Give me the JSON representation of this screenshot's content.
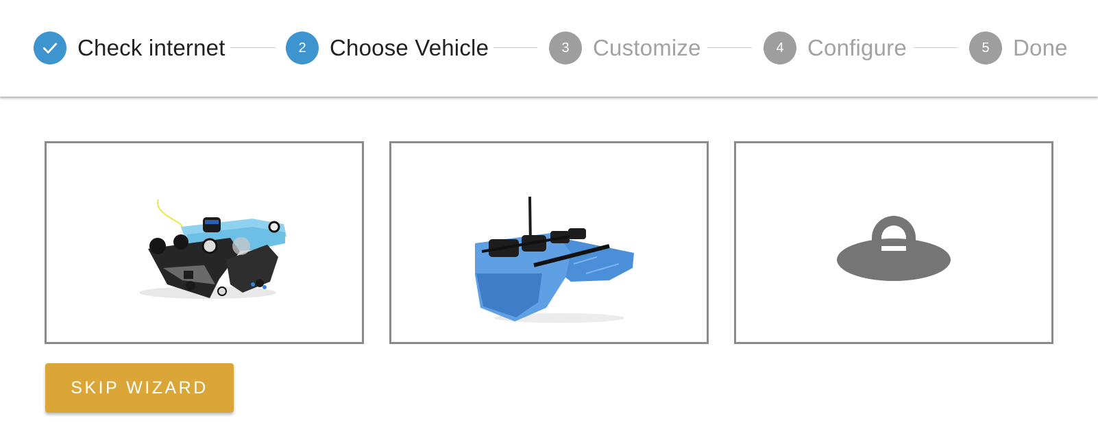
{
  "colors": {
    "accent": "#3d94cf",
    "pending": "#9e9e9e",
    "button": "#daa638",
    "card_border": "#8a8a8a"
  },
  "stepper": {
    "steps": [
      {
        "number": "1",
        "label": "Check internet",
        "state": "complete",
        "icon": "check-icon"
      },
      {
        "number": "2",
        "label": "Choose Vehicle",
        "state": "active"
      },
      {
        "number": "3",
        "label": "Customize",
        "state": "pending"
      },
      {
        "number": "4",
        "label": "Configure",
        "state": "pending"
      },
      {
        "number": "5",
        "label": "Done",
        "state": "pending"
      }
    ]
  },
  "vehicles": [
    {
      "id": "rov",
      "icon": "underwater-rov-image"
    },
    {
      "id": "boat",
      "icon": "catamaran-boat-image"
    },
    {
      "id": "other",
      "icon": "ufo-icon"
    }
  ],
  "actions": {
    "skip_label": "SKIP WIZARD"
  }
}
